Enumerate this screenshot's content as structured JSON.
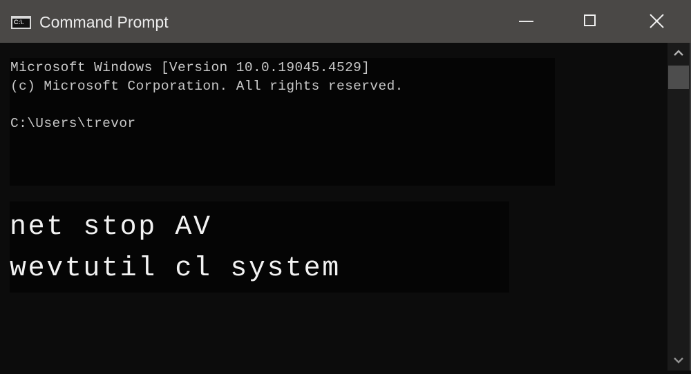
{
  "window": {
    "title": "Command Prompt",
    "icon_text": "C:\\.",
    "icon": "cmd-icon",
    "controls": {
      "minimize": "minimize-icon",
      "maximize": "maximize-icon",
      "close": "close-icon"
    }
  },
  "console": {
    "lines": [
      "Microsoft Windows [Version 10.0.19045.4529]",
      "(c) Microsoft Corporation. All rights reserved.",
      "",
      "C:\\Users\\trevor"
    ],
    "commands": [
      "net stop AV",
      "wevtutil cl system"
    ]
  },
  "scrollbar": {
    "up": "chevron-up-icon",
    "down": "chevron-down-icon"
  },
  "colors": {
    "titlebar": "#4a4846",
    "console_bg": "#0c0c0c",
    "text": "#c8c8c8",
    "command_text": "#f2f2f2",
    "scroll_thumb": "#4d4d4d"
  }
}
